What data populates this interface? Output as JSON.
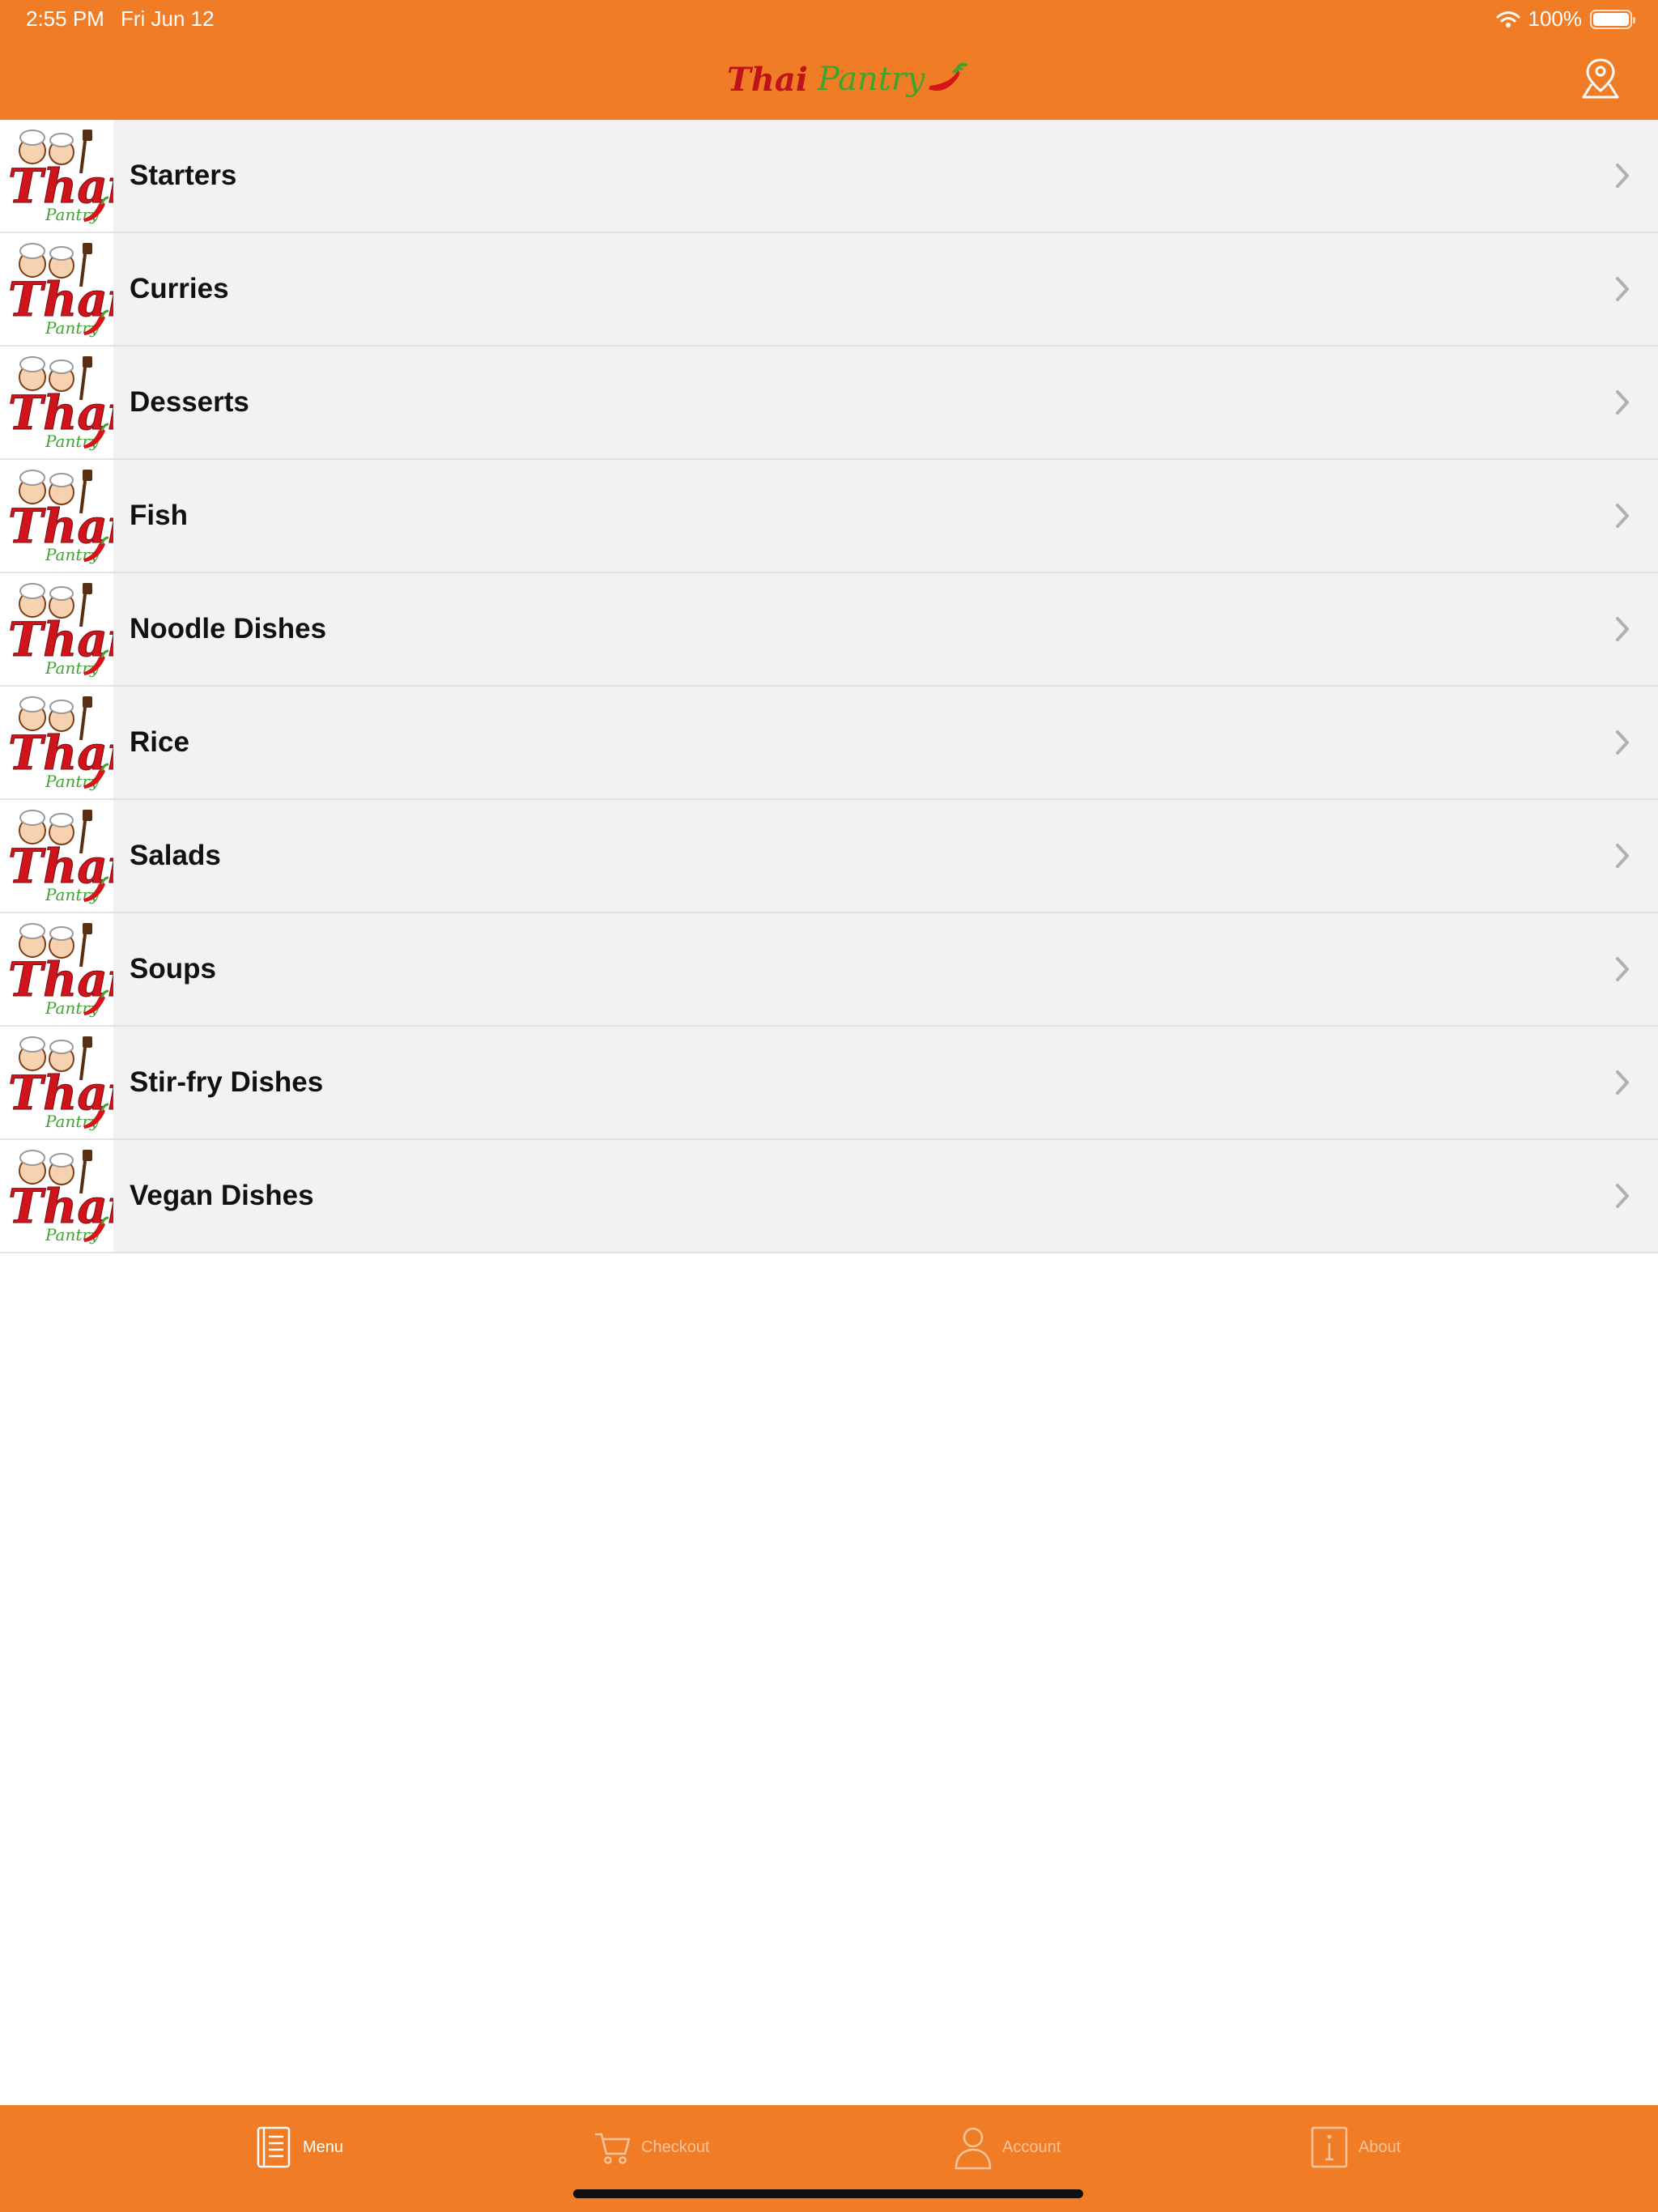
{
  "status_bar": {
    "time": "2:55 PM",
    "date": "Fri Jun 12",
    "battery": "100%"
  },
  "header": {
    "logo_word1": "Thai",
    "logo_word2": "Pantry",
    "location_icon": "map-pin-icon"
  },
  "menu_categories": [
    {
      "label": "Starters"
    },
    {
      "label": "Curries"
    },
    {
      "label": "Desserts"
    },
    {
      "label": "Fish"
    },
    {
      "label": "Noodle Dishes"
    },
    {
      "label": "Rice"
    },
    {
      "label": "Salads"
    },
    {
      "label": "Soups"
    },
    {
      "label": "Stir-fry Dishes"
    },
    {
      "label": "Vegan Dishes"
    }
  ],
  "tab_bar": {
    "tabs": [
      {
        "label": "Menu",
        "icon": "menu-book-icon",
        "active": true
      },
      {
        "label": "Checkout",
        "icon": "cart-icon",
        "active": false
      },
      {
        "label": "Account",
        "icon": "user-icon",
        "active": false
      },
      {
        "label": "About",
        "icon": "info-icon",
        "active": false
      }
    ]
  },
  "colors": {
    "brand_orange": "#F07D26",
    "row_background": "#F2F2F2",
    "logo_red": "#C0121A",
    "logo_green": "#3DA52B"
  }
}
